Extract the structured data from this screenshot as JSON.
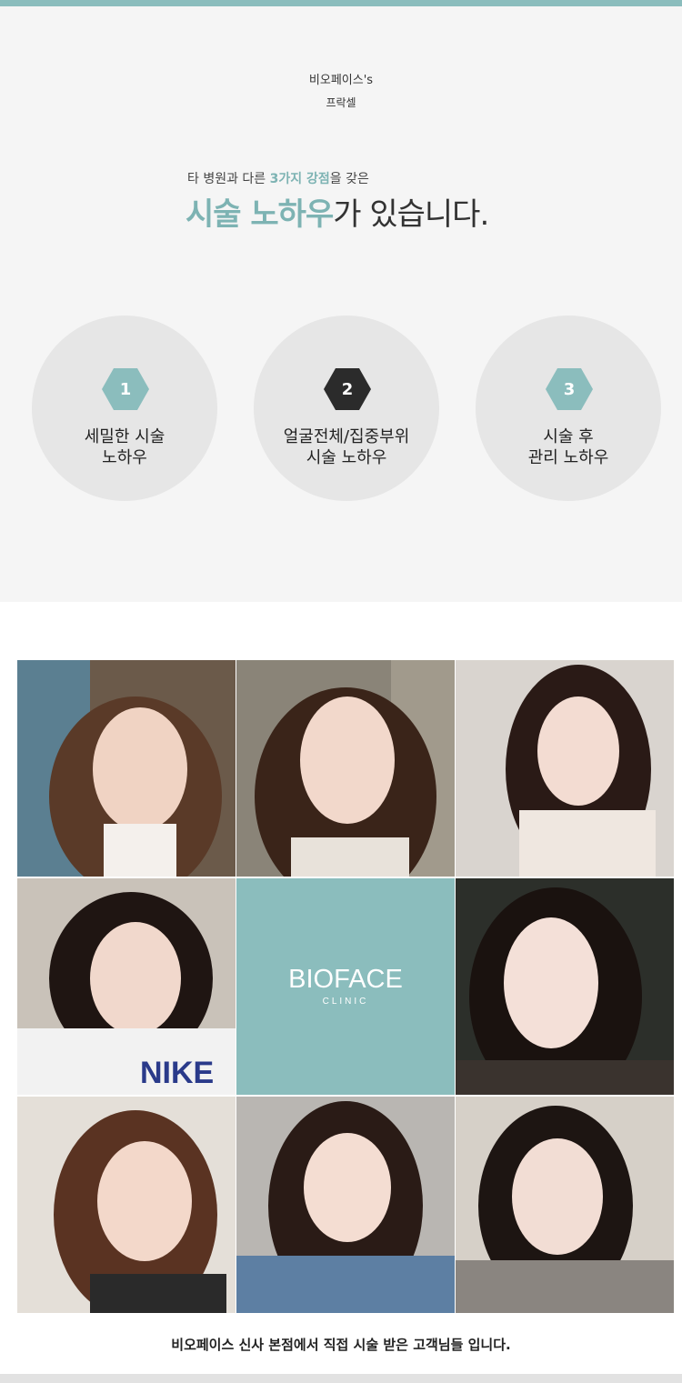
{
  "header": {
    "brand_line1": "비오페이스's",
    "brand_line2": "프락셀"
  },
  "intro": {
    "line_pre": "타 병원과 다른 ",
    "line_highlight": "3가지 강점",
    "line_post": "을 갖은",
    "headline_highlight": "시술 노하우",
    "headline_post": "가 있습니다."
  },
  "features": [
    {
      "number": "1",
      "label_line1": "세밀한 시술",
      "label_line2": "노하우",
      "badge_color": "#8bbdbd"
    },
    {
      "number": "2",
      "label_line1": "얼굴전체/집중부위",
      "label_line2": "시술 노하우",
      "badge_color": "#2b2b2b"
    },
    {
      "number": "3",
      "label_line1": "시술 후",
      "label_line2": "관리 노하우",
      "badge_color": "#8bbdbd"
    }
  ],
  "gallery": {
    "logo_main": "BIOFACE",
    "logo_sub": "CLINIC",
    "photo_count": 8
  },
  "caption": "비오페이스 신사 본점에서 직접 시술 받은 고객님들 입니다.",
  "colors": {
    "accent": "#8bbdbd",
    "section_bg": "#f5f5f5",
    "circle_bg": "#e6e6e6"
  }
}
